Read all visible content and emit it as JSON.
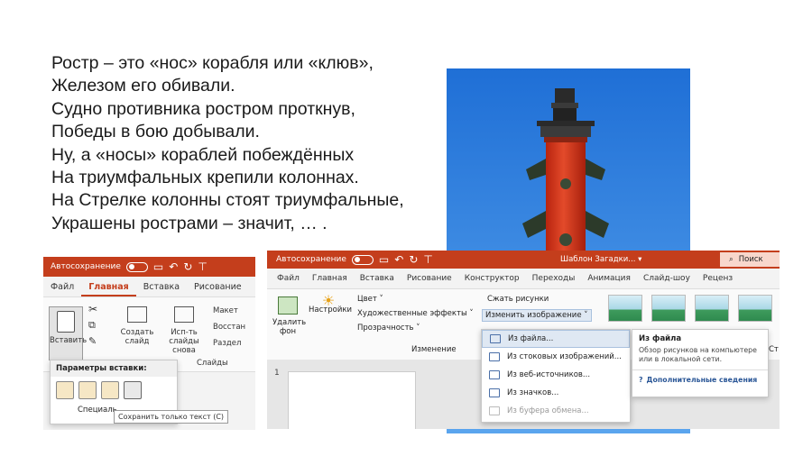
{
  "poem": {
    "lines": [
      "Ростр – это «нос» корабля или «клюв»,",
      "Железом его обивали.",
      "Судно противника ростром проткнув,",
      "Победы в бою добывали.",
      "Ну, а «носы» кораблей побеждённых",
      "На триумфальных крепили колоннах.",
      "На Стрелке колонны стоят триумфальные,",
      "Украшены рострами – значит, … ."
    ]
  },
  "left_screenshot": {
    "titlebar": {
      "autosave": "Автосохранение"
    },
    "tabs": [
      "Файл",
      "Главная",
      "Вставка",
      "Рисование"
    ],
    "ribbon": {
      "paste": "Вставить",
      "create_slide": "Создать слайд",
      "reuse_slides": "Исп-ть слайды снова",
      "layout": "Макет",
      "restore": "Восстан",
      "section": "Раздел",
      "group_slides": "Слайды"
    },
    "paste_menu": {
      "header": "Параметры вставки:",
      "special": "Специаль",
      "tooltip": "Сохранить только текст (C)"
    }
  },
  "right_screenshot": {
    "titlebar": {
      "autosave": "Автосохранение",
      "doc_title": "Шаблон Загадки... ▾",
      "search": "Поиск"
    },
    "tabs": [
      "Файл",
      "Главная",
      "Вставка",
      "Рисование",
      "Конструктор",
      "Переходы",
      "Анимация",
      "Слайд-шоу",
      "Реценз"
    ],
    "ribbon": {
      "remove_bg": "Удалить фон",
      "settings": "Настройки",
      "color": "Цвет ˅",
      "art_effects": "Художественные эффекты ˅",
      "transparency": "Прозрачность ˅",
      "compress": "Сжать рисунки",
      "change_picture": "Изменить изображение ˅",
      "group_change": "Изменение",
      "stub": "Ст"
    },
    "slide_number": "1",
    "menu": {
      "items": [
        "Из файла...",
        "Из стоковых изображений...",
        "Из веб-источников...",
        "Из значков...",
        "Из буфера обмена..."
      ]
    },
    "tooltip": {
      "title": "Из файла",
      "body": "Обзор рисунков на компьютере или в локальной сети.",
      "link": "Дополнительные сведения"
    }
  },
  "colors": {
    "office_red": "#c43e1c",
    "sky": "#2f7fdc",
    "column": "#d9361c"
  }
}
